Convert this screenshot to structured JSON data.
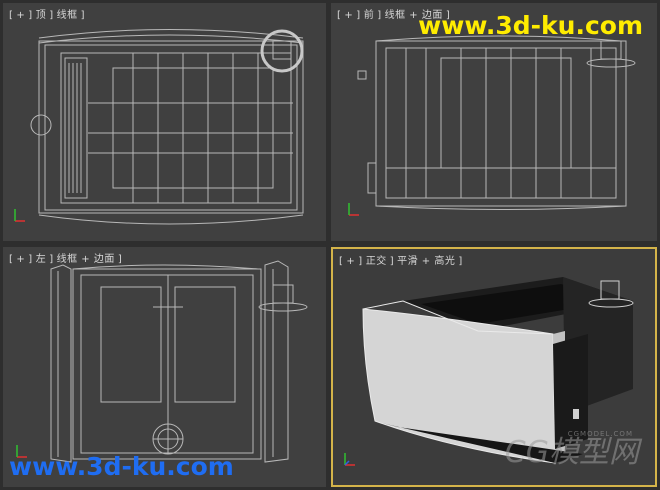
{
  "viewports": {
    "top": {
      "label_parts": [
        "[",
        "+",
        "]",
        "顶",
        "]",
        "线框",
        "]"
      ]
    },
    "front": {
      "label_parts": [
        "[",
        "+",
        "]",
        "前",
        "]",
        "线框 + 边面",
        "]"
      ]
    },
    "left": {
      "label_parts": [
        "[",
        "+",
        "]",
        "左",
        "]",
        "线框 + 边面",
        "]"
      ]
    },
    "perspective": {
      "label_parts": [
        "[",
        "+",
        "]",
        "正交",
        "]",
        "平滑 + 高光",
        "]"
      ]
    }
  },
  "watermarks": {
    "top_right": "www.3d-ku.com",
    "bottom_left": "www.3d-ku.com",
    "cg_logo": "CG模型网",
    "cg_small": "CGMODEL.COM"
  },
  "colors": {
    "viewport_bg": "#404040",
    "active_border": "#d4b44a",
    "wire": "#b8b8b8",
    "watermark_yellow": "#ffec00",
    "watermark_blue": "#1f6df2"
  }
}
